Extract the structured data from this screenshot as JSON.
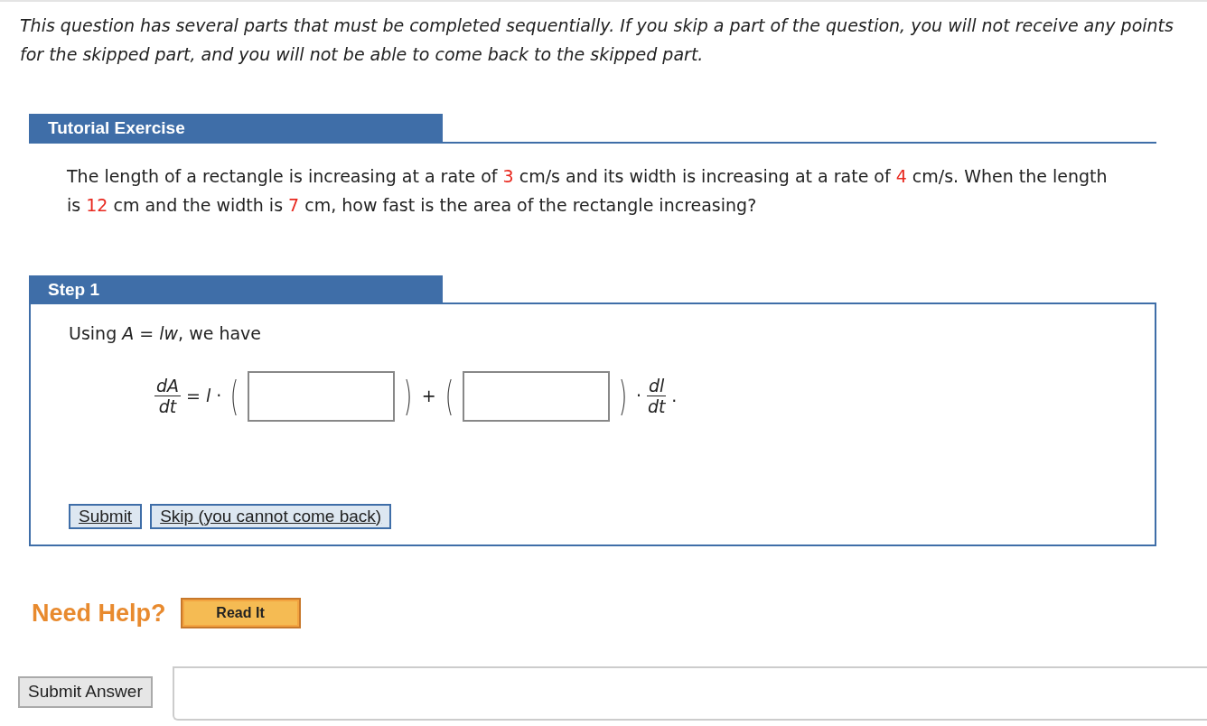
{
  "notice": "This question has several parts that must be completed sequentially. If you skip a part of the question, you will not receive any points for the skipped part, and you will not be able to come back to the skipped part.",
  "tutorial": {
    "title": "Tutorial Exercise",
    "question": [
      {
        "kind": "text",
        "text": "The length of a rectangle is increasing at a rate of "
      },
      {
        "kind": "value",
        "text": "3"
      },
      {
        "kind": "text",
        "text": " cm/s and its width is increasing at a rate of "
      },
      {
        "kind": "value",
        "text": "4"
      },
      {
        "kind": "text",
        "text": " cm/s. When the length is "
      },
      {
        "kind": "value",
        "text": "12"
      },
      {
        "kind": "text",
        "text": " cm and the width is "
      },
      {
        "kind": "value",
        "text": "7"
      },
      {
        "kind": "text",
        "text": " cm, how fast is the area of the rectangle increasing?"
      }
    ]
  },
  "step": {
    "title": "Step 1",
    "intro": "Using *A* = *lw*, we have",
    "equation": [
      {
        "kind": "fraction",
        "numerator": "dA",
        "denominator": "dt"
      },
      {
        "kind": "symbol",
        "text": "="
      },
      {
        "kind": "variable",
        "text": "l"
      },
      {
        "kind": "symbol",
        "text": "·"
      },
      {
        "kind": "paren",
        "text": "("
      },
      {
        "kind": "input"
      },
      {
        "kind": "paren",
        "text": ")"
      },
      {
        "kind": "symbol",
        "text": "+"
      },
      {
        "kind": "paren",
        "text": "("
      },
      {
        "kind": "input"
      },
      {
        "kind": "paren",
        "text": ")"
      },
      {
        "kind": "symbol",
        "text": "·"
      },
      {
        "kind": "fraction",
        "numerator": "dl",
        "denominator": "dt"
      },
      {
        "kind": "symbol",
        "text": "."
      }
    ],
    "buttons": [
      "Submit",
      "Skip (you cannot come back)"
    ]
  },
  "help": {
    "label": "Need Help?",
    "buttons": [
      "Read It"
    ]
  },
  "submit_answer": "Submit Answer"
}
